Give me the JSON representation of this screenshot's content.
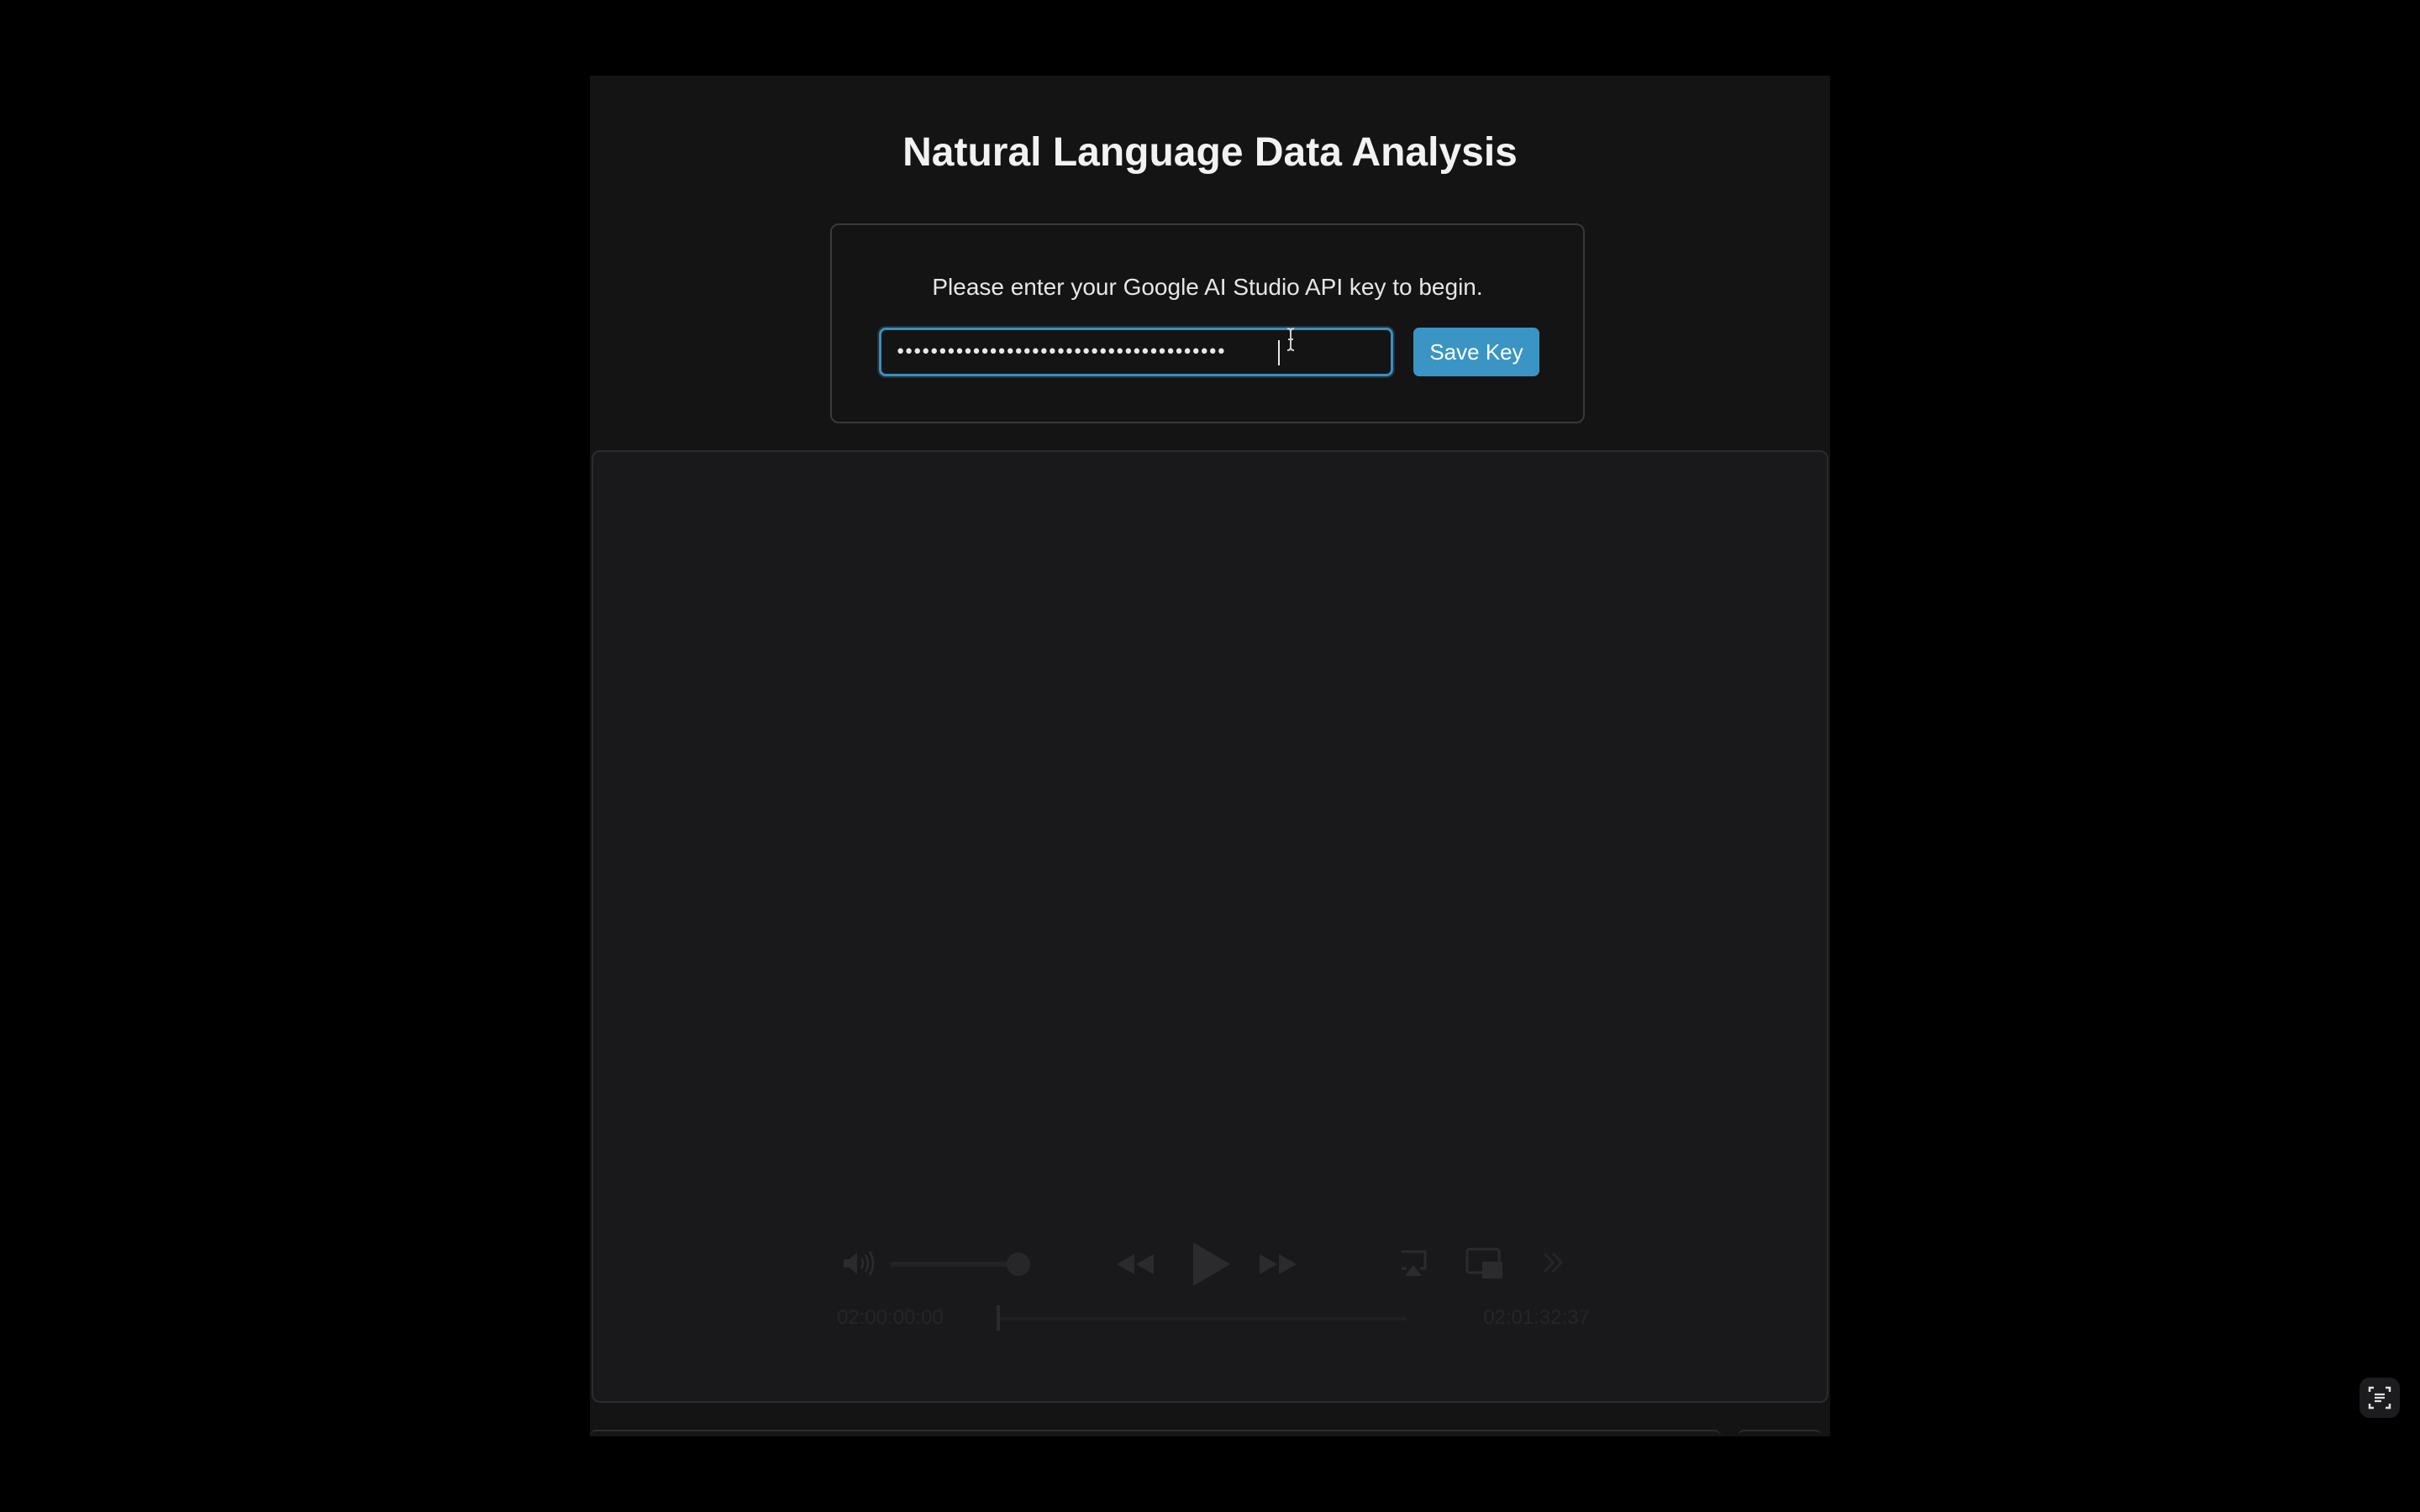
{
  "app": {
    "title": "Natural Language Data Analysis"
  },
  "api_card": {
    "prompt": "Please enter your Google AI Studio API key to begin.",
    "key_masked": "•••••••••••••••••••••••••••••••••••••••",
    "save_label": "Save Key"
  },
  "player": {
    "time_elapsed": "02:00:00:00",
    "time_total": "02:01:32:37",
    "volume_level": 0.95,
    "progress": 0.0
  },
  "colors": {
    "background": "#000000",
    "frame": "#141415",
    "accent": "#3a95c4",
    "input_border": "#3a8fbd"
  },
  "icons": {
    "speaker": "speaker-icon",
    "rewind": "rewind-icon",
    "play": "play-icon",
    "fast_forward": "fast-forward-icon",
    "airplay": "airplay-icon",
    "picture_in_picture": "picture-in-picture-icon",
    "expand": "expand-icon",
    "live_text": "live-text-icon"
  }
}
